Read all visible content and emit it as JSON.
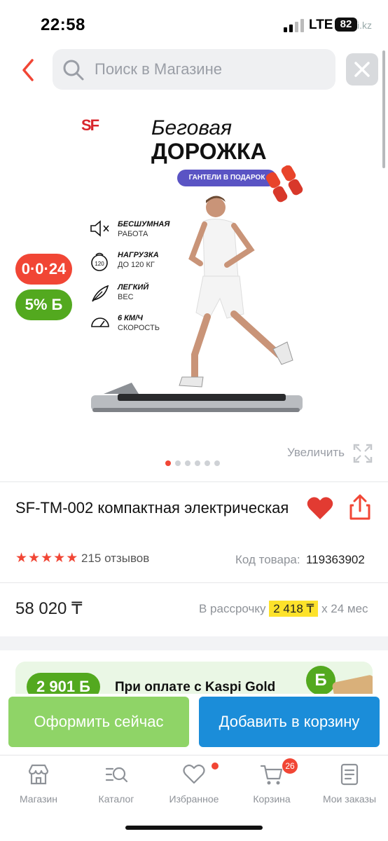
{
  "status_bar": {
    "time": "22:58",
    "network": "LTE",
    "battery": "82",
    "overlay": "i.kz"
  },
  "search": {
    "placeholder": "Поиск в Магазине",
    "value": ""
  },
  "gallery": {
    "banner": {
      "logo": "SF",
      "heading_1": "Беговая",
      "heading_2": "ДОРОЖКА",
      "gift": "ГАНТЕЛИ В ПОДАРОК",
      "features": [
        {
          "title": "БЕСШУМНАЯ",
          "subtitle": "РАБОТА",
          "icon": "speaker-mute-icon"
        },
        {
          "title": "НАГРУЗКА",
          "subtitle": "ДО 120 КГ",
          "icon": "weight-icon"
        },
        {
          "title": "ЛЕГКИЙ",
          "subtitle": "ВЕС",
          "icon": "feather-icon"
        },
        {
          "title": "6 КМ/Ч",
          "subtitle": "СКОРОСТЬ",
          "icon": "speedometer-icon"
        }
      ]
    },
    "badges": {
      "installment": "0·0·24",
      "bonus": "5% Б"
    },
    "zoom_label": "Увеличить",
    "slides_total": 6,
    "active_slide": 1
  },
  "product": {
    "title": "SF-TM-002 компактная электрическая",
    "rating": 5,
    "reviews": "215 отзывов",
    "code_label": "Код товара:",
    "code_value": "119363902"
  },
  "price": {
    "value": "58 020 ₸",
    "installment_prefix": "В рассрочку",
    "installment_amount": "2 418 ₸",
    "installment_suffix": "х 24 мес"
  },
  "promo": {
    "bonus": "2 901 Б",
    "text": "При оплате с Kaspi Gold"
  },
  "actions": {
    "buy_now": "Оформить сейчас",
    "add_to_cart": "Добавить в корзину"
  },
  "tabbar": {
    "items": [
      {
        "label": "Магазин"
      },
      {
        "label": "Каталог"
      },
      {
        "label": "Избранное"
      },
      {
        "label": "Корзина",
        "badge": "26"
      },
      {
        "label": "Мои заказы"
      }
    ]
  },
  "colors": {
    "accent_red": "#f14635",
    "green": "#53a91f",
    "blue": "#1b8dd9",
    "light_green": "#8fd467",
    "highlight": "#fde22b"
  }
}
